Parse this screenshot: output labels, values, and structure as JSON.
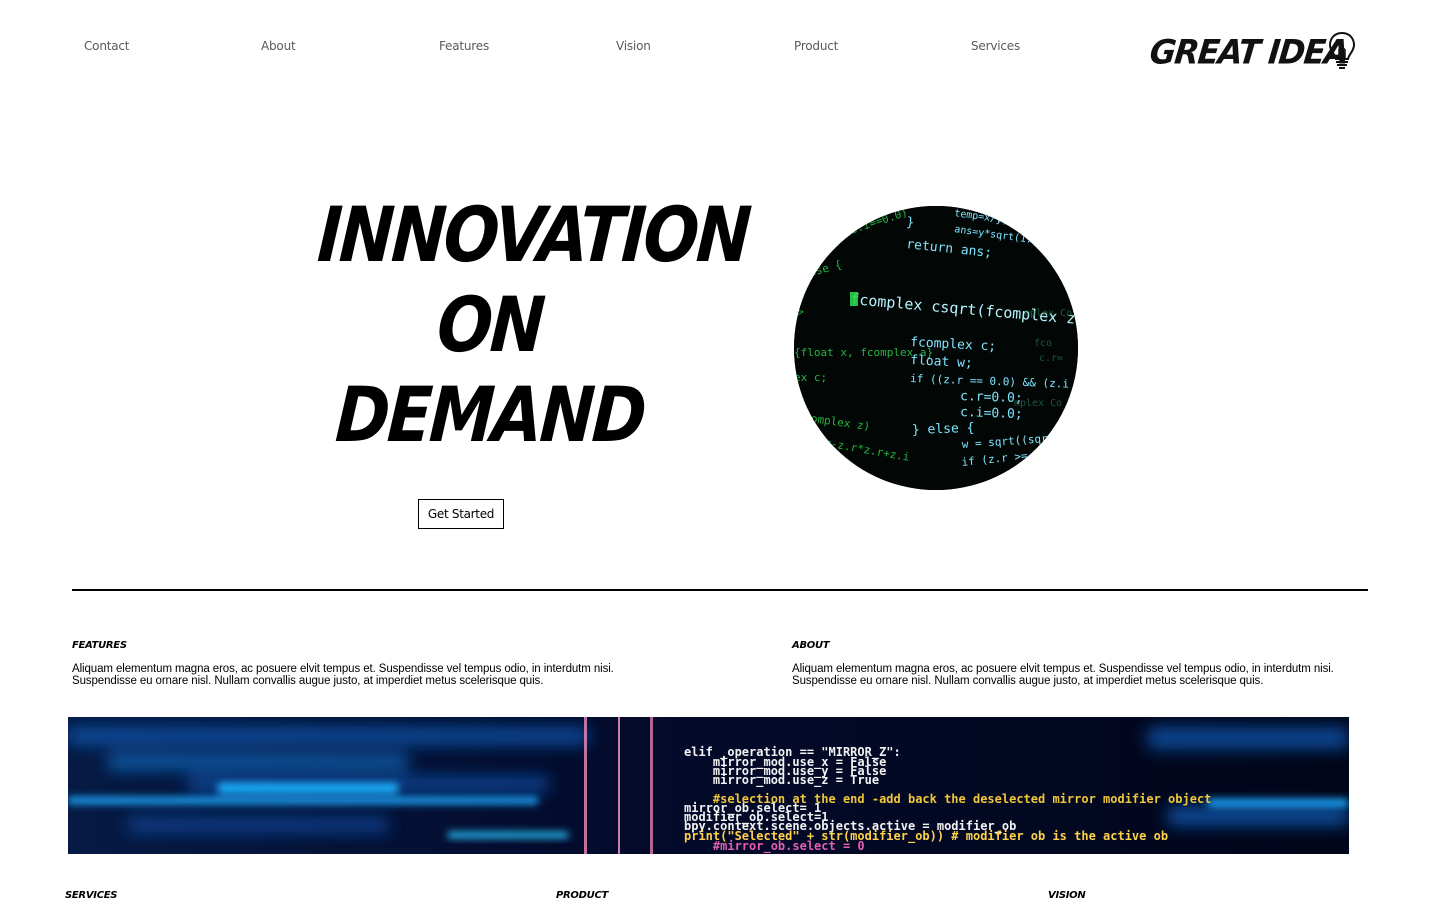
{
  "nav": {
    "items": [
      "Contact",
      "About",
      "Features",
      "Vision",
      "Product",
      "Services"
    ]
  },
  "logo": {
    "text": "GREAT IDEA",
    "icon": "lightbulb-icon"
  },
  "hero": {
    "title_lines": [
      "Innovation",
      "On",
      "Demand"
    ],
    "cta_label": "Get Started",
    "image": "code-screen-circle"
  },
  "features": {
    "title": "Features",
    "body": "Aliquam elementum magna eros, ac posuere elvit tempus et. Suspendisse vel tempus odio, in interdutm nisi. Suspendisse eu ornare nisl. Nullam convallis augue justo, at imperdiet metus scelerisque quis."
  },
  "about": {
    "title": "About",
    "body": "Aliquam elementum magna eros, ac posuere elvit tempus et. Suspendisse vel tempus odio, in interdutm nisi. Suspendisse eu ornare nisl. Nullam convallis augue justo, at imperdiet metus scelerisque quis."
  },
  "banner": {
    "code_lines": [
      "elif _operation == \"MIRROR_Z\":",
      "    mirror_mod.use_x = False",
      "    mirror_mod.use_y = False",
      "    mirror_mod.use_z = True",
      "",
      "    #selection at the end -add back the deselected mirror modifier object",
      "mirror_ob.select= 1",
      "modifier_ob.select=1",
      "bpy.context.scene.objects.active = modifier_ob",
      "print(\"Selected\" + str(modifier_ob)) # modifier ob is the active ob",
      "    #mirror_ob.select = 0"
    ]
  },
  "bottom_sections": [
    "Services",
    "Product",
    "Vision"
  ],
  "colors": {
    "text": "#000000",
    "nav_text": "#5a5a5a",
    "banner_bg": "#02061e",
    "code_green": "#27d83c",
    "code_cyan": "#3fd6ff"
  }
}
